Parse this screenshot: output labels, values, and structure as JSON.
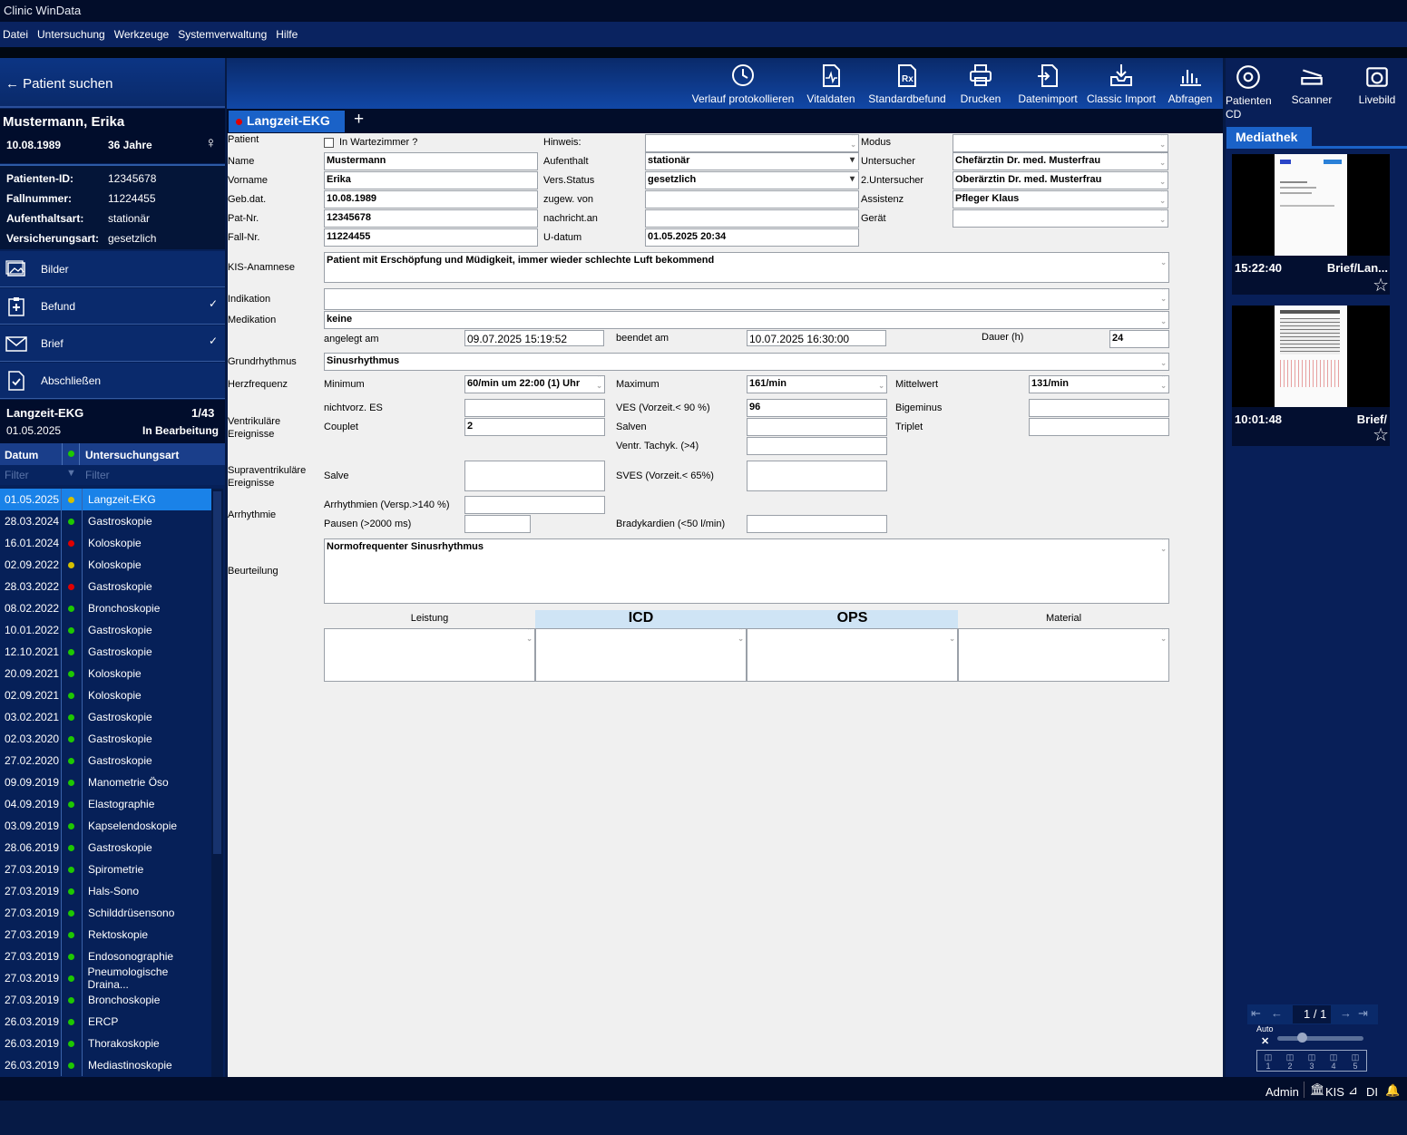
{
  "app": {
    "title": "Clinic WinData"
  },
  "menu": [
    "Datei",
    "Untersuchung",
    "Werkzeuge",
    "Systemverwaltung",
    "Hilfe"
  ],
  "left": {
    "search_label": "Patient suchen",
    "patient_name": "Mustermann, Erika",
    "birthdate": "10.08.1989",
    "age": "36 Jahre",
    "info": [
      {
        "label": "Patienten-ID:",
        "value": "12345678"
      },
      {
        "label": "Fallnummer:",
        "value": "11224455"
      },
      {
        "label": "Aufenthaltsart:",
        "value": "stationär"
      },
      {
        "label": "Versicherungsart:",
        "value": "gesetzlich"
      }
    ],
    "nav": [
      {
        "label": "Bilder",
        "checked": false,
        "icon": "images-icon"
      },
      {
        "label": "Befund",
        "checked": true,
        "icon": "clipboard-icon"
      },
      {
        "label": "Brief",
        "checked": true,
        "icon": "envelope-icon"
      },
      {
        "label": "Abschließen",
        "checked": false,
        "icon": "document-check-icon"
      }
    ],
    "exam": {
      "title": "Langzeit-EKG",
      "counter": "1/43",
      "date": "01.05.2025",
      "status": "In Bearbeitung"
    },
    "table": {
      "col_date": "Datum",
      "col_type": "Untersuchungsart",
      "filter_placeholder": "Filter",
      "rows": [
        {
          "date": "01.05.2025",
          "status": "#d4c000",
          "type": "Langzeit-EKG",
          "selected": true
        },
        {
          "date": "28.03.2024",
          "status": "#1ec800",
          "type": "Gastroskopie"
        },
        {
          "date": "16.01.2024",
          "status": "#e00000",
          "type": "Koloskopie"
        },
        {
          "date": "02.09.2022",
          "status": "#d4c000",
          "type": "Koloskopie"
        },
        {
          "date": "28.03.2022",
          "status": "#e00000",
          "type": "Gastroskopie"
        },
        {
          "date": "08.02.2022",
          "status": "#1ec800",
          "type": "Bronchoskopie"
        },
        {
          "date": "10.01.2022",
          "status": "#1ec800",
          "type": "Gastroskopie"
        },
        {
          "date": "12.10.2021",
          "status": "#1ec800",
          "type": "Gastroskopie"
        },
        {
          "date": "20.09.2021",
          "status": "#1ec800",
          "type": "Koloskopie"
        },
        {
          "date": "02.09.2021",
          "status": "#1ec800",
          "type": "Koloskopie"
        },
        {
          "date": "03.02.2021",
          "status": "#1ec800",
          "type": "Gastroskopie"
        },
        {
          "date": "02.03.2020",
          "status": "#1ec800",
          "type": "Gastroskopie"
        },
        {
          "date": "27.02.2020",
          "status": "#1ec800",
          "type": "Gastroskopie"
        },
        {
          "date": "09.09.2019",
          "status": "#1ec800",
          "type": "Manometrie Öso"
        },
        {
          "date": "04.09.2019",
          "status": "#1ec800",
          "type": "Elastographie"
        },
        {
          "date": "03.09.2019",
          "status": "#1ec800",
          "type": "Kapselendoskopie"
        },
        {
          "date": "28.06.2019",
          "status": "#1ec800",
          "type": "Gastroskopie"
        },
        {
          "date": "27.03.2019",
          "status": "#1ec800",
          "type": "Spirometrie"
        },
        {
          "date": "27.03.2019",
          "status": "#1ec800",
          "type": "Hals-Sono"
        },
        {
          "date": "27.03.2019",
          "status": "#1ec800",
          "type": "Schilddrüsensono"
        },
        {
          "date": "27.03.2019",
          "status": "#1ec800",
          "type": "Rektoskopie"
        },
        {
          "date": "27.03.2019",
          "status": "#1ec800",
          "type": "Endosonographie"
        },
        {
          "date": "27.03.2019",
          "status": "#1ec800",
          "type": "Pneumologische Draina..."
        },
        {
          "date": "27.03.2019",
          "status": "#1ec800",
          "type": "Bronchoskopie"
        },
        {
          "date": "26.03.2019",
          "status": "#1ec800",
          "type": "ERCP"
        },
        {
          "date": "26.03.2019",
          "status": "#1ec800",
          "type": "Thorakoskopie"
        },
        {
          "date": "26.03.2019",
          "status": "#1ec800",
          "type": "Mediastinoskopie"
        }
      ]
    }
  },
  "toolbar": [
    {
      "label": "Verlauf protokollieren",
      "icon": "history-icon"
    },
    {
      "label": "Vitaldaten",
      "icon": "vitals-icon"
    },
    {
      "label": "Standardbefund",
      "icon": "prescription-icon"
    },
    {
      "label": "Drucken",
      "icon": "printer-icon"
    },
    {
      "label": "Datenimport",
      "icon": "import-icon"
    },
    {
      "label": "Classic Import",
      "icon": "download-tray-icon"
    },
    {
      "label": "Abfragen",
      "icon": "bar-chart-icon"
    }
  ],
  "tab": {
    "label": "Langzeit-EKG",
    "add": "+"
  },
  "form": {
    "patient_label": "Patient",
    "wartezimmer_label": "In Wartezimmer ?",
    "name_label": "Name",
    "name": "Mustermann",
    "vorname_label": "Vorname",
    "vorname": "Erika",
    "gebdat_label": "Geb.dat.",
    "gebdat": "10.08.1989",
    "patnr_label": "Pat-Nr.",
    "patnr": "12345678",
    "fallnr_label": "Fall-Nr.",
    "fallnr": "11224455",
    "hinweis_label": "Hinweis:",
    "hinweis": "",
    "aufenthalt_label": "Aufenthalt",
    "aufenthalt": "stationär",
    "versstatus_label": "Vers.Status",
    "versstatus": "gesetzlich",
    "zugew_label": "zugew. von",
    "zugew": "",
    "nachricht_label": "nachricht.an",
    "nachricht": "",
    "udatum_label": "U-datum",
    "udatum": "01.05.2025 20:34",
    "modus_label": "Modus",
    "modus": "",
    "untersucher_label": "Untersucher",
    "untersucher": "Chefärztin Dr. med. Musterfrau",
    "untersucher2_label": "2.Untersucher",
    "untersucher2": "Oberärztin Dr. med. Musterfrau",
    "assistenz_label": "Assistenz",
    "assistenz": "Pfleger Klaus",
    "geraet_label": "Gerät",
    "geraet": "",
    "kis_label": "KIS-Anamnese",
    "kis": "Patient mit Erschöpfung und Müdigkeit, immer wieder schlechte Luft bekommend",
    "indikation_label": "Indikation",
    "indikation": "",
    "medikation_label": "Medikation",
    "medikation": "keine",
    "angelegt_label": "angelegt am",
    "angelegt": "09.07.2025 15:19:52",
    "beendet_label": "beendet am",
    "beendet": "10.07.2025 16:30:00",
    "dauer_label": "Dauer (h)",
    "dauer": "24",
    "grundrhythmus_label": "Grundrhythmus",
    "grundrhythmus": "Sinusrhythmus",
    "hf_label": "Herzfrequenz",
    "minimum_label": "Minimum",
    "minimum": "60/min um 22:00 (1) Uhr",
    "maximum_label": "Maximum",
    "maximum": "161/min",
    "mittel_label": "Mittelwert",
    "mittel": "131/min",
    "ventr_label": "Ventrikuläre Ereignisse",
    "nichtvorz_label": "nichtvorz. ES",
    "nichtvorz": "",
    "ves_label": "VES (Vorzeit.< 90 %)",
    "ves": "96",
    "bigeminus_label": "Bigeminus",
    "bigeminus": "",
    "couplet_label": "Couplet",
    "couplet": "2",
    "salven_label": "Salven",
    "salven": "",
    "triplet_label": "Triplet",
    "triplet": "",
    "tachyk_label": "Ventr. Tachyk. (>4)",
    "tachyk": "",
    "supra_label": "Supraventrikuläre Ereignisse",
    "salve_label": "Salve",
    "salve": "",
    "sves_label": "SVES (Vorzeit.< 65%)",
    "sves": "",
    "arrhythmie_label": "Arrhythmie",
    "arrhythmien_label": "Arrhythmien (Versp.>140 %)",
    "arrhythmien": "",
    "pausen_label": "Pausen (>2000 ms)",
    "pausen": "",
    "brady_label": "Bradykardien (<50 l/min)",
    "brady": "",
    "beurteilung_label": "Beurteilung",
    "beurteilung": "Normofrequenter Sinusrhythmus",
    "leistung_label": "Leistung",
    "icd_label": "ICD",
    "ops_label": "OPS",
    "material_label": "Material"
  },
  "right": {
    "toolbar": [
      {
        "label": "Patienten CD",
        "icon": "disc-icon"
      },
      {
        "label": "Scanner",
        "icon": "scanner-icon"
      },
      {
        "label": "Livebild",
        "icon": "camera-icon"
      }
    ],
    "media_tab": "Mediathek",
    "thumbs": [
      {
        "time": "15:22:40",
        "name": "Brief/Lan..."
      },
      {
        "time": "10:01:48",
        "name": "Brief/"
      }
    ],
    "pager": {
      "current": "1",
      "total": "/ 1",
      "auto": "Auto",
      "pages": [
        "1",
        "2",
        "3",
        "4",
        "5"
      ]
    }
  },
  "status": {
    "user": "Admin",
    "kis": "KIS",
    "di": "DI"
  }
}
